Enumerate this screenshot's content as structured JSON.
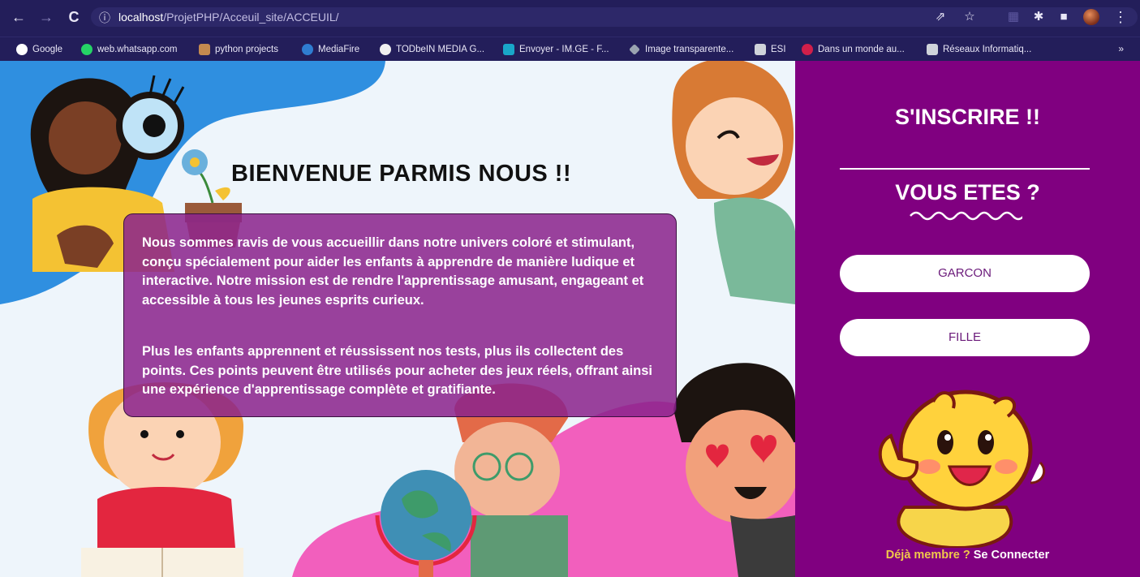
{
  "browser": {
    "url_host": "localhost",
    "url_path": "/ProjetPHP/Acceuil_site/ACCEUIL/",
    "bookmarks": [
      {
        "label": "Google",
        "color": "#ffffff",
        "icon": "google-icon"
      },
      {
        "label": "web.whatsapp.com",
        "color": "#25d366",
        "icon": "whatsapp-icon"
      },
      {
        "label": "python projects",
        "color": "#c58a4f",
        "icon": "folder-icon"
      },
      {
        "label": "MediaFire",
        "color": "#2f7dd1",
        "icon": "mediafire-icon"
      },
      {
        "label": "TODbeIN MEDIA G...",
        "color": "#f0f0f0",
        "icon": "globe-icon"
      },
      {
        "label": "Envoyer - IM.GE - F...",
        "color": "#19a7c9",
        "icon": "upload-icon"
      },
      {
        "label": "Image transparente...",
        "color": "#9aa3b0",
        "icon": "diamond-icon"
      },
      {
        "label": "ESI",
        "color": "#cfd3da",
        "icon": "page-icon"
      },
      {
        "label": "Dans un monde au...",
        "color": "#d11f4a",
        "icon": "pinterest-icon"
      },
      {
        "label": "Réseaux Informatiq...",
        "color": "#cfd3da",
        "icon": "page-icon"
      }
    ],
    "more_label": "»"
  },
  "hero": {
    "title": "BIENVENUE PARMIS NOUS !!",
    "paragraph1": "Nous sommes ravis de vous accueillir dans notre univers coloré et stimulant, conçu spécialement pour aider les enfants à apprendre de manière ludique et interactive. Notre mission est de rendre l'apprentissage amusant, engageant et accessible à tous les jeunes esprits curieux.",
    "paragraph2": "Plus les enfants apprennent et réussissent nos tests, plus ils collectent des points. Ces points peuvent être utilisés pour acheter des jeux réels, offrant ainsi une expérience d'apprentissage complète et gratifiante."
  },
  "panel": {
    "title": "S'INSCRIRE !!",
    "subtitle": "VOUS ETES ?",
    "choice_boy": "GARCON",
    "choice_girl": "FILLE",
    "member_question": "Déjà membre ?",
    "login_link": "Se Connecter"
  },
  "colors": {
    "browser_bar": "#231e5a",
    "panel": "#800080",
    "card": "#8a238c",
    "blob_blue": "#2f8fe0",
    "blob_pink": "#f25fbd"
  }
}
